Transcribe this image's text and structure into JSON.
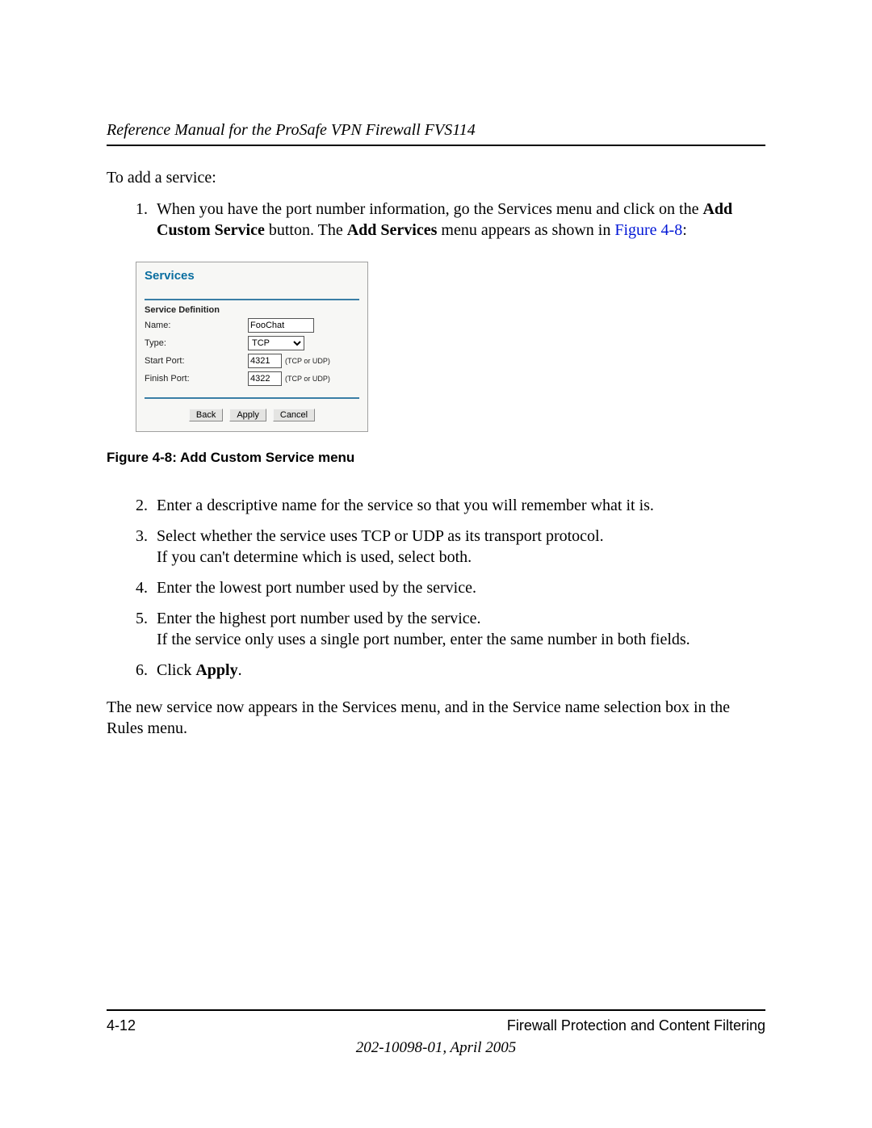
{
  "header": {
    "title": "Reference Manual for the ProSafe VPN Firewall FVS114"
  },
  "intro": "To add a service:",
  "step1": {
    "t1": "When you have the port number information, go the Services menu and click on the ",
    "b1": "Add Custom Service",
    "t2": " button. The ",
    "b2": "Add Services",
    "t3": " menu appears as shown in ",
    "link": "Figure 4-8",
    "t4": ":"
  },
  "figure": {
    "heading": "Services",
    "section": "Service Definition",
    "labels": {
      "name": "Name:",
      "type": "Type:",
      "start": "Start Port:",
      "finish": "Finish Port:"
    },
    "values": {
      "name": "FooChat",
      "type": "TCP",
      "start": "4321",
      "finish": "4322"
    },
    "hint": "(TCP or UDP)",
    "buttons": {
      "back": "Back",
      "apply": "Apply",
      "cancel": "Cancel"
    }
  },
  "caption": "Figure 4-8:  Add Custom Service menu",
  "step2": "Enter a descriptive name for the service so that you will remember what it is.",
  "step3": {
    "l1": "Select whether the service uses TCP or UDP as its transport protocol.",
    "l2": "If you can't determine which is used, select both."
  },
  "step4": "Enter the lowest port number used by the service.",
  "step5": {
    "l1": "Enter the highest port number used by the service.",
    "l2": "If the service only uses a single port number, enter the same number in both fields."
  },
  "step6": {
    "t1": "Click ",
    "b1": "Apply",
    "t2": "."
  },
  "closing": "The new service now appears in the Services menu, and in the Service name selection box in the Rules menu.",
  "footer": {
    "page": "4-12",
    "section": "Firewall Protection and Content Filtering",
    "doc": "202-10098-01, April 2005"
  }
}
